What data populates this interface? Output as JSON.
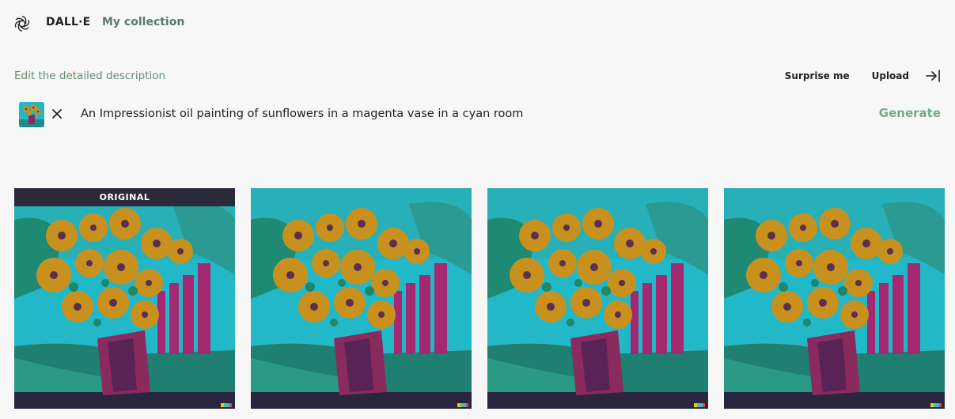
{
  "header": {
    "brand": "DALL·E",
    "collection_link": "My collection"
  },
  "editor": {
    "label": "Edit the detailed description",
    "surprise_label": "Surprise me",
    "upload_label": "Upload",
    "prompt": "An Impressionist oil painting of sunflowers in a magenta vase in a cyan room",
    "generate_label": "Generate"
  },
  "gallery": {
    "items": [
      {
        "badge": "ORIGINAL"
      },
      {
        "badge": ""
      },
      {
        "badge": ""
      },
      {
        "badge": ""
      }
    ]
  },
  "icons": {
    "logo": "openai-logo-icon",
    "collapse": "collapse-panel-icon",
    "clear": "close-icon"
  },
  "colors": {
    "background": "#f7f7f8",
    "accent_green": "#5f8f73",
    "generate_disabled": "#7aa88b",
    "badge_bg": "#2b2a3a",
    "painting_cyan": "#22b8c8",
    "painting_magenta": "#8a2a5e",
    "painting_yellow": "#c8911e"
  }
}
